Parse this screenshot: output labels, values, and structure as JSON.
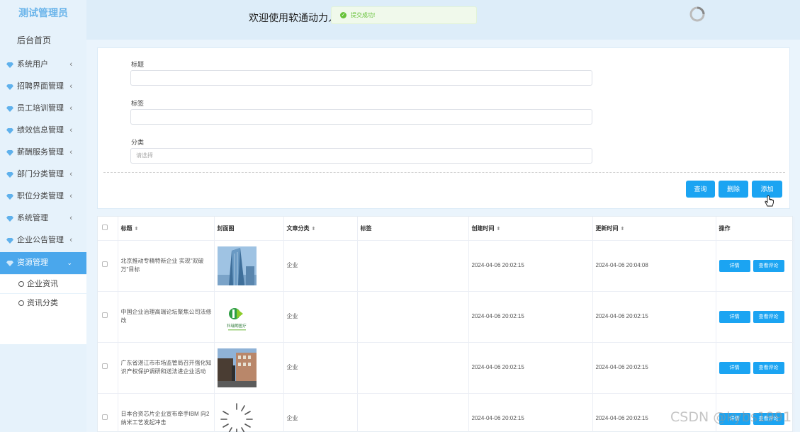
{
  "sidebar": {
    "brand": "测试管理员",
    "home": "后台首页",
    "items": [
      {
        "label": "系统用户"
      },
      {
        "label": "招聘界面管理"
      },
      {
        "label": "员工培训管理"
      },
      {
        "label": "绩效信息管理"
      },
      {
        "label": "薪酬服务管理"
      },
      {
        "label": "部门分类管理"
      },
      {
        "label": "职位分类管理"
      },
      {
        "label": "系统管理"
      },
      {
        "label": "企业公告管理"
      },
      {
        "label": "资源管理"
      }
    ],
    "sub_items": [
      {
        "label": "企业资讯"
      },
      {
        "label": "资讯分类"
      }
    ]
  },
  "header": {
    "welcome": "欢迎使用软通动力人才",
    "toast": "提交成功!"
  },
  "search": {
    "title_label": "标题",
    "tag_label": "标签",
    "category_label": "分类",
    "category_placeholder": "请选择",
    "query_button": "查询",
    "delete_button": "删除",
    "add_button": "添加"
  },
  "table": {
    "headers": {
      "title": "标题",
      "cover": "封面图",
      "category": "文章分类",
      "tag": "标签",
      "created": "创建时间",
      "updated": "更新时间",
      "actions": "操作"
    },
    "detail_label": "详情",
    "comments_label": "查看评论",
    "rows": [
      {
        "title": "北京推动专精特新企业 实现\"双破万\"目标",
        "category": "企业",
        "tag": "",
        "created": "2024-04-06 20:02:15",
        "updated": "2024-04-06 20:04:08"
      },
      {
        "title": "中国企业治理高端论坛聚焦公司法修改",
        "category": "企业",
        "tag": "",
        "created": "2024-04-06 20:02:15",
        "updated": "2024-04-06 20:02:15"
      },
      {
        "title": "广东省湛江市市场监管局召开强化知识产权保护调研和送法进企业活动",
        "category": "企业",
        "tag": "",
        "created": "2024-04-06 20:02:15",
        "updated": "2024-04-06 20:02:15"
      },
      {
        "title": "日本合资芯片企业宣布牵手IBM 向2纳米工艺发起冲击",
        "category": "企业",
        "tag": "",
        "created": "2024-04-06 20:02:15",
        "updated": "2024-04-06 20:02:15"
      }
    ],
    "logo_text": "科瑞朗医疗"
  },
  "watermark": "CSDN @kybs1991",
  "colors": {
    "accent": "#1ba4f2",
    "sidebar_bg": "#e6f2fb",
    "sidebar_active": "#4aa7ec",
    "brand": "#6ab4ea",
    "success": "#67c23a"
  }
}
